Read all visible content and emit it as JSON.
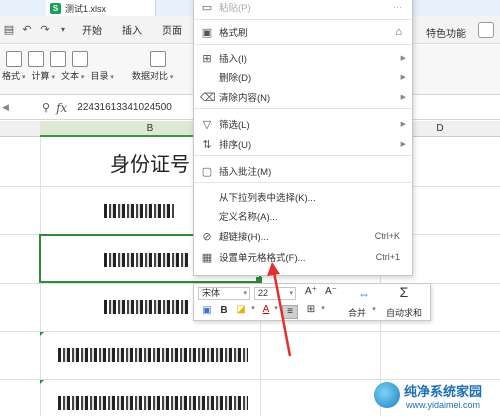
{
  "file_tab": {
    "icon_letter": "S",
    "filename": "测试1.xlsx"
  },
  "menubar": {
    "quick_access_icons": [
      "save-icon",
      "undo-icon",
      "redo-icon",
      "dropdown-icon"
    ],
    "items": [
      "开始",
      "插入",
      "页面"
    ],
    "special": "特色功能"
  },
  "ribbon": {
    "labels": [
      "格式",
      "计算",
      "文本",
      "目录",
      "",
      "数据对比"
    ]
  },
  "formula_bar": {
    "value": "22431613341024500"
  },
  "columns": {
    "b": "B",
    "d": "D"
  },
  "sheet": {
    "header_text": "身份证号"
  },
  "context_menu": {
    "paste": "粘贴(P)",
    "format_painter": "格式刷",
    "insert": "插入(I)",
    "delete": "删除(D)",
    "clear": "清除内容(N)",
    "filter": "筛选(L)",
    "sort": "排序(U)",
    "insert_comment": "插入批注(M)",
    "pick_from_list": "从下拉列表中选择(K)...",
    "define_name": "定义名称(A)...",
    "hyperlink": "超链接(H)...",
    "hyperlink_shortcut": "Ctrl+K",
    "format_cells": "设置单元格格式(F)...",
    "format_cells_shortcut": "Ctrl+1"
  },
  "mini_toolbar": {
    "font_name": "宋体",
    "font_size": "22",
    "bold": "B",
    "merge": "合并",
    "autosum": "自动求和"
  },
  "watermark": {
    "title": "纯净系统家园",
    "url": "www.yidaimei.com"
  },
  "colors": {
    "accent_green": "#2e8b3c",
    "arrow_red": "#e0312f",
    "watermark_blue": "#1d6fb3"
  }
}
